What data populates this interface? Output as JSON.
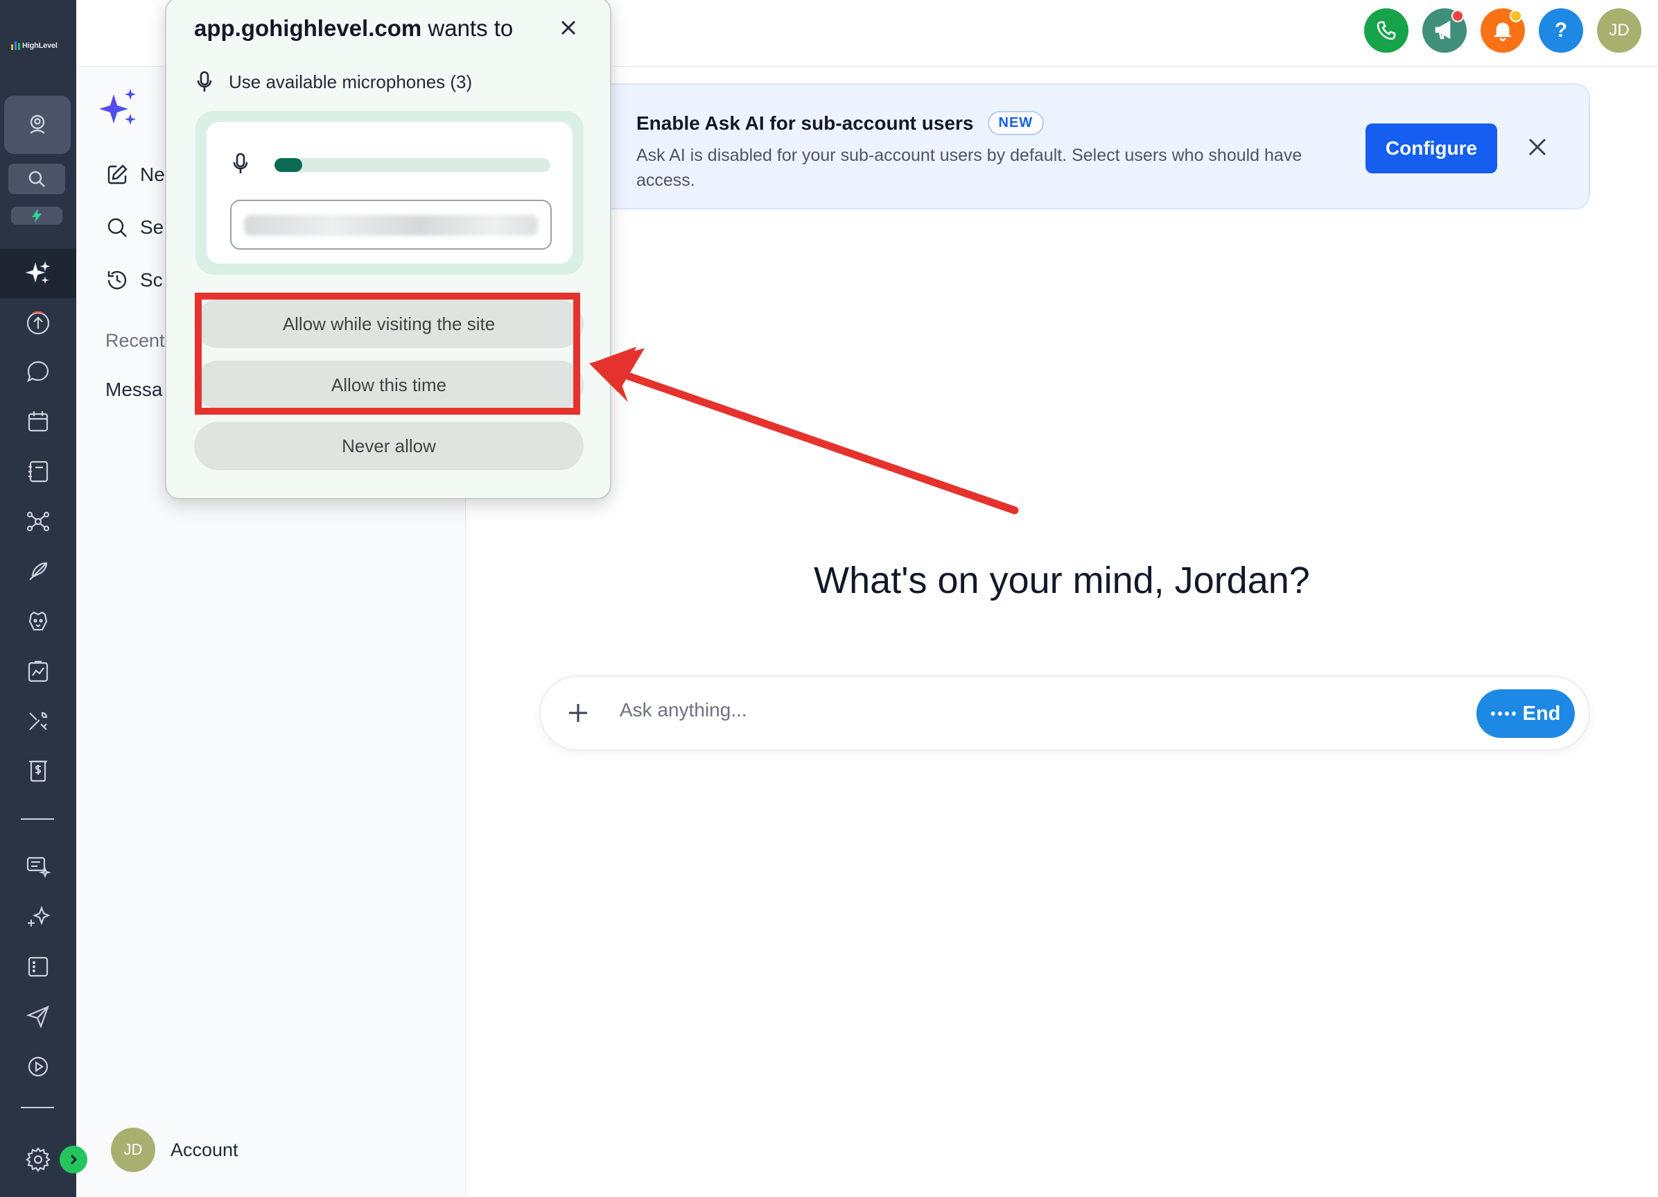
{
  "rail": {
    "logo_text": "HighLevel"
  },
  "sidebar": {
    "items": [
      {
        "label": "Ne",
        "icon": "edit-icon"
      },
      {
        "label": "Se",
        "icon": "search-icon"
      },
      {
        "label": "Sc",
        "icon": "history-icon"
      }
    ],
    "recent_label": "Recent",
    "recent_items": [
      "Messa"
    ],
    "account": {
      "initials": "JD",
      "label": "Account"
    }
  },
  "topbar": {
    "avatar_initials": "JD",
    "help_symbol": "?"
  },
  "banner": {
    "title": "Enable Ask AI for sub-account users",
    "badge": "NEW",
    "description": "Ask AI is disabled for your sub-account users by default. Select users who should have access.",
    "configure_label": "Configure"
  },
  "main": {
    "greeting": "What's on your mind, Jordan?",
    "composer": {
      "placeholder": "Ask anything...",
      "end_label": "End"
    }
  },
  "permission_popup": {
    "site": "app.gohighlevel.com",
    "wants_to": " wants to",
    "permission": "Use available microphones (3)",
    "mic_level": 0.1,
    "buttons": {
      "allow_visiting": "Allow while visiting the site",
      "allow_once": "Allow this time",
      "never": "Never allow"
    }
  },
  "colors": {
    "rail_bg": "#2b3445",
    "primary_blue": "#155eef",
    "highlight_red": "#e5322d",
    "phone_green": "#16a34a",
    "notification_orange": "#f97316"
  }
}
